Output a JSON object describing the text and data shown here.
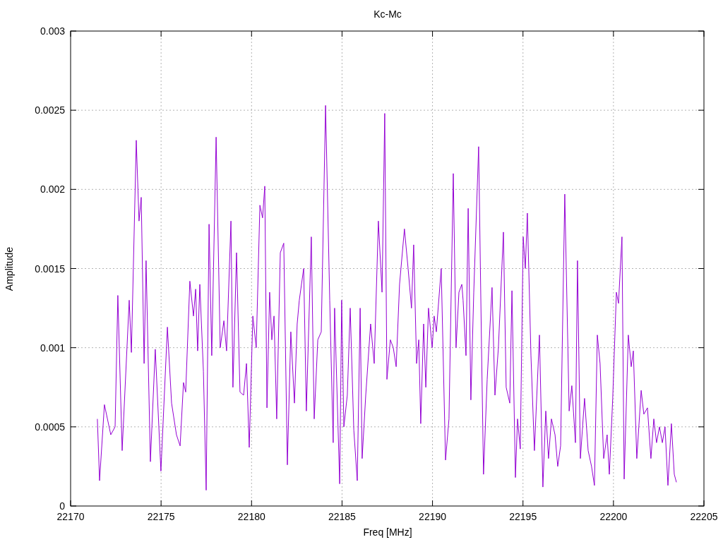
{
  "chart_data": {
    "type": "line",
    "grid": true,
    "title": "Kc-Mc",
    "xlabel": "Freq [MHz]",
    "ylabel": "Amplitude",
    "xlim": [
      22170,
      22205
    ],
    "ylim": [
      0,
      0.003
    ],
    "xticks": [
      22170,
      22175,
      22180,
      22185,
      22190,
      22195,
      22200,
      22205
    ],
    "yticks": [
      {
        "value": 0,
        "label": "0"
      },
      {
        "value": 0.0005,
        "label": "0.0005"
      },
      {
        "value": 0.001,
        "label": "0.001"
      },
      {
        "value": 0.0015,
        "label": "0.0015"
      },
      {
        "value": 0.002,
        "label": "0.002"
      },
      {
        "value": 0.0025,
        "label": "0.0025"
      },
      {
        "value": 0.003,
        "label": "0.003"
      }
    ],
    "x": [
      22171.48,
      22171.6,
      22171.87,
      22172.22,
      22172.46,
      22172.61,
      22172.85,
      22173.24,
      22173.36,
      22173.63,
      22173.78,
      22173.9,
      22174.06,
      22174.17,
      22174.41,
      22174.68,
      22174.99,
      22175.35,
      22175.58,
      22175.85,
      22176.05,
      22176.24,
      22176.36,
      22176.59,
      22176.79,
      22176.91,
      22177.02,
      22177.14,
      22177.34,
      22177.49,
      22177.65,
      22177.8,
      22178.04,
      22178.27,
      22178.47,
      22178.62,
      22178.86,
      22178.97,
      22179.17,
      22179.36,
      22179.56,
      22179.72,
      22179.87,
      22180.07,
      22180.26,
      22180.46,
      22180.61,
      22180.73,
      22180.85,
      22181.0,
      22181.12,
      22181.24,
      22181.39,
      22181.59,
      22181.78,
      22181.98,
      22182.17,
      22182.37,
      22182.52,
      22182.64,
      22182.88,
      22183.03,
      22183.3,
      22183.46,
      22183.66,
      22183.85,
      22184.09,
      22184.32,
      22184.51,
      22184.59,
      22184.87,
      22184.98,
      22185.1,
      22185.29,
      22185.45,
      22185.65,
      22185.84,
      22186.0,
      22186.11,
      22186.31,
      22186.58,
      22186.78,
      22187.01,
      22187.21,
      22187.36,
      22187.48,
      22187.67,
      22187.83,
      22187.99,
      22188.18,
      22188.45,
      22188.65,
      22188.84,
      22188.96,
      22189.12,
      22189.24,
      22189.35,
      22189.51,
      22189.63,
      22189.78,
      22189.98,
      22190.09,
      22190.21,
      22190.48,
      22190.72,
      22190.91,
      22191.15,
      22191.3,
      22191.46,
      22191.62,
      22191.69,
      22191.85,
      22191.97,
      22192.12,
      22192.28,
      22192.55,
      22192.71,
      22192.82,
      22193.02,
      22193.29,
      22193.45,
      22193.64,
      22193.92,
      22194.07,
      22194.27,
      22194.39,
      22194.58,
      22194.7,
      22194.85,
      22195.01,
      22195.13,
      22195.24,
      22195.44,
      22195.63,
      22195.91,
      22196.1,
      22196.26,
      22196.41,
      22196.57,
      22196.77,
      22196.92,
      22197.08,
      22197.31,
      22197.55,
      22197.7,
      22197.9,
      22198.01,
      22198.17,
      22198.4,
      22198.6,
      22198.79,
      22198.95,
      22199.11,
      22199.26,
      22199.46,
      22199.65,
      22199.77,
      22199.96,
      22200.16,
      22200.28,
      22200.47,
      22200.59,
      22200.82,
      22200.98,
      22201.1,
      22201.29,
      22201.53,
      22201.68,
      22201.88,
      22202.07,
      22202.23,
      22202.38,
      22202.54,
      22202.7,
      22202.85,
      22203.01,
      22203.2,
      22203.36,
      22203.48
    ],
    "series": [
      {
        "color": "#9400d3",
        "values": [
          0.00055,
          0.00016,
          0.00064,
          0.00045,
          0.0005,
          0.00133,
          0.00035,
          0.0013,
          0.00097,
          0.00231,
          0.0018,
          0.00195,
          0.0009,
          0.00155,
          0.00028,
          0.00099,
          0.00022,
          0.00113,
          0.00065,
          0.00045,
          0.00038,
          0.00078,
          0.00072,
          0.00142,
          0.0012,
          0.00137,
          0.00098,
          0.0014,
          0.00085,
          0.0001,
          0.00178,
          0.00095,
          0.00233,
          0.001,
          0.00117,
          0.00098,
          0.0018,
          0.00075,
          0.0016,
          0.00072,
          0.0007,
          0.0009,
          0.00037,
          0.0012,
          0.001,
          0.0019,
          0.00182,
          0.00202,
          0.00062,
          0.00135,
          0.00105,
          0.0012,
          0.00055,
          0.0016,
          0.00166,
          0.00026,
          0.0011,
          0.00065,
          0.00115,
          0.0013,
          0.0015,
          0.0006,
          0.0017,
          0.00055,
          0.00105,
          0.0011,
          0.00253,
          0.0013,
          0.0004,
          0.00125,
          0.00014,
          0.0013,
          0.0005,
          0.0007,
          0.00125,
          0.00048,
          0.00016,
          0.00125,
          0.0003,
          0.0007,
          0.00115,
          0.0009,
          0.0018,
          0.00135,
          0.00248,
          0.0008,
          0.00105,
          0.001,
          0.00088,
          0.0014,
          0.00175,
          0.0015,
          0.00125,
          0.00165,
          0.0009,
          0.00105,
          0.00052,
          0.00115,
          0.00075,
          0.00125,
          0.001,
          0.0012,
          0.0011,
          0.0015,
          0.00029,
          0.00055,
          0.0021,
          0.001,
          0.00135,
          0.0014,
          0.0013,
          0.00095,
          0.00188,
          0.00067,
          0.00135,
          0.00227,
          0.001,
          0.0002,
          0.0008,
          0.00138,
          0.0007,
          0.001,
          0.00173,
          0.00075,
          0.00065,
          0.00136,
          0.00018,
          0.00055,
          0.00036,
          0.0017,
          0.0015,
          0.00185,
          0.00095,
          0.00035,
          0.00108,
          0.00012,
          0.0006,
          0.0003,
          0.00055,
          0.00045,
          0.00025,
          0.00038,
          0.00197,
          0.0006,
          0.00076,
          0.0004,
          0.00155,
          0.0003,
          0.00068,
          0.00035,
          0.00025,
          0.00013,
          0.00108,
          0.0009,
          0.0003,
          0.00045,
          0.0002,
          0.00068,
          0.00135,
          0.00128,
          0.0017,
          0.00017,
          0.00108,
          0.00088,
          0.00098,
          0.0003,
          0.00073,
          0.00058,
          0.00062,
          0.0003,
          0.00055,
          0.0004,
          0.0005,
          0.0004,
          0.0005,
          0.00013,
          0.00052,
          0.0002,
          0.00015
        ]
      }
    ]
  }
}
